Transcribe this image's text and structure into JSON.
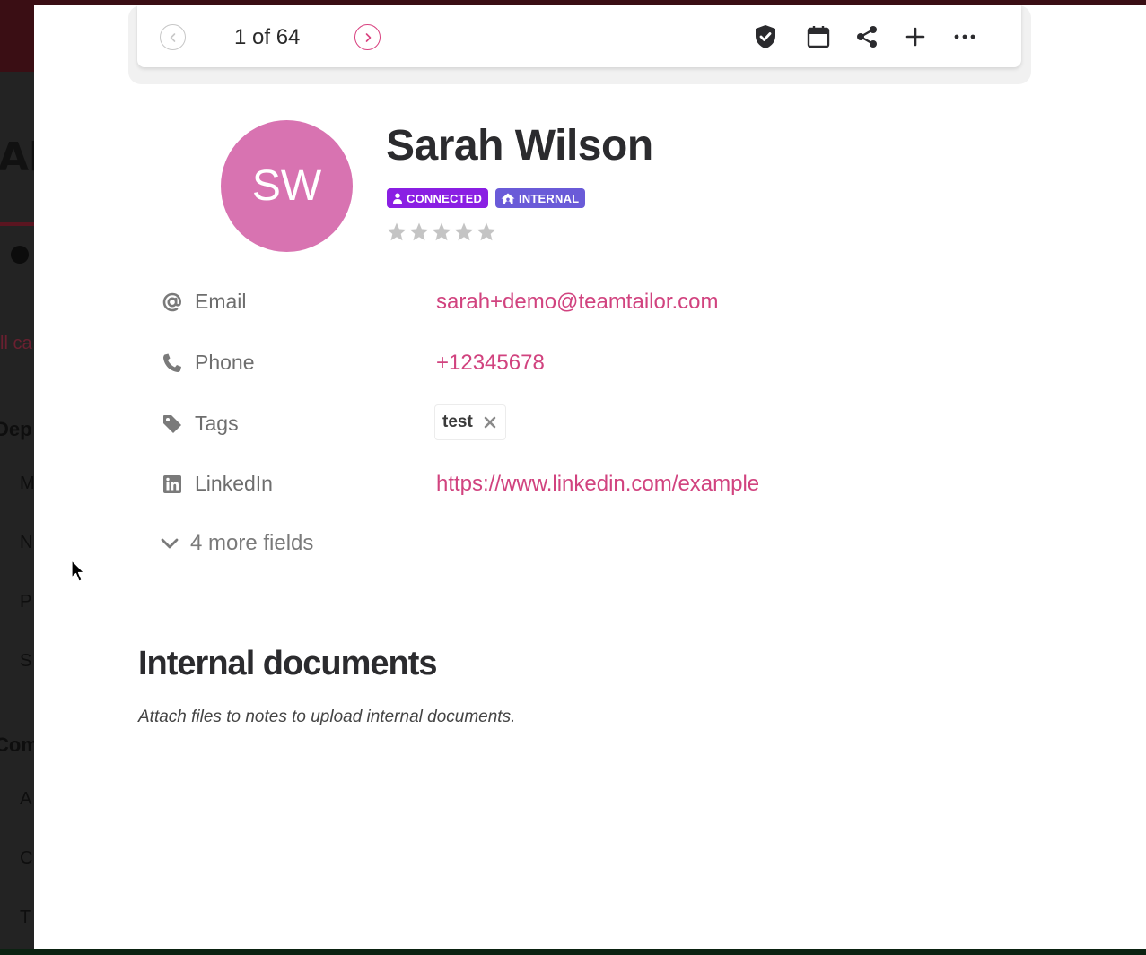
{
  "toolbar": {
    "pager_text": "1 of 64",
    "prev_icon": "chevron-left-icon",
    "next_icon": "chevron-right-icon",
    "actions": [
      "shield-check-icon",
      "calendar-icon",
      "share-icon",
      "plus-icon",
      "more-horizontal-icon"
    ]
  },
  "candidate": {
    "initials": "SW",
    "name": "Sarah Wilson",
    "avatar_color": "#d873b1",
    "badges": [
      {
        "label": "CONNECTED",
        "icon": "user-icon",
        "color": "#8a1fe3"
      },
      {
        "label": "INTERNAL",
        "icon": "home-icon",
        "color": "#6a5bd8"
      }
    ],
    "rating": 0,
    "rating_max": 5
  },
  "fields": {
    "email": {
      "label": "Email",
      "value": "sarah+demo@teamtailor.com",
      "icon": "at-icon"
    },
    "phone": {
      "label": "Phone",
      "value": "+12345678",
      "icon": "phone-icon"
    },
    "tags": {
      "label": "Tags",
      "values": [
        "test"
      ],
      "icon": "tag-icon"
    },
    "linkedin": {
      "label": "LinkedIn",
      "value": "https://www.linkedin.com/example",
      "icon": "linkedin-icon"
    },
    "more": "4 more fields"
  },
  "internal_documents": {
    "title": "Internal documents",
    "description": "Attach files to notes to upload internal documents."
  },
  "colors": {
    "accent": "#d1437f",
    "text_dark": "#2b2b2e",
    "label_gray": "#6e6e6e"
  }
}
